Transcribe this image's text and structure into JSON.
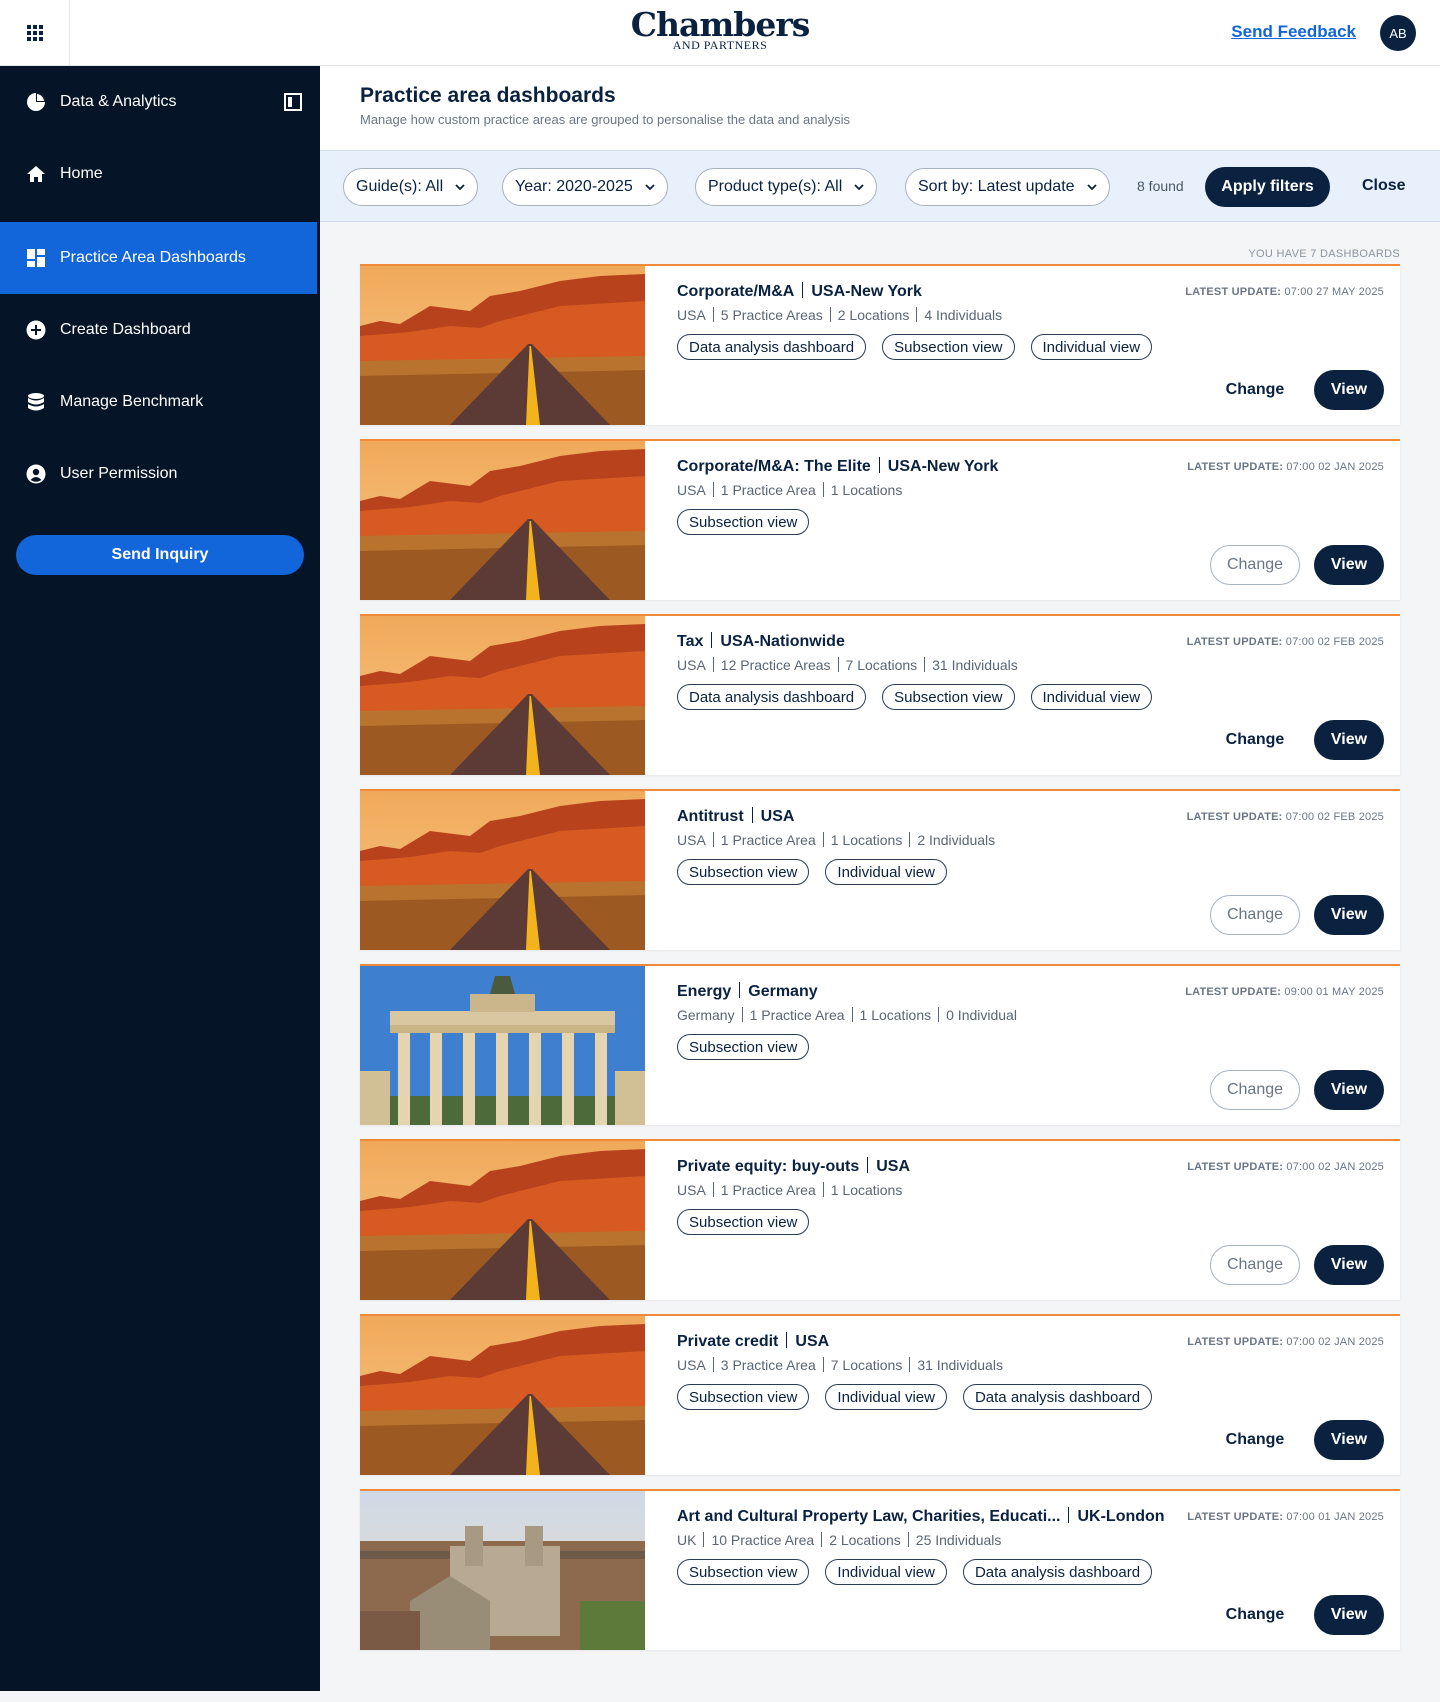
{
  "header": {
    "logo_line1": "Chambers",
    "logo_line2": "AND PARTNERS",
    "feedback": "Send Feedback",
    "avatar": "AB"
  },
  "sidebar": {
    "section": "Data & Analytics",
    "items": [
      {
        "label": "Home",
        "icon": "home-icon"
      },
      {
        "label": "Practice Area Dashboards",
        "icon": "dashboard-icon",
        "active": true
      },
      {
        "label": "Create Dashboard",
        "icon": "plus-circle-icon"
      },
      {
        "label": "Manage Benchmark",
        "icon": "database-icon"
      },
      {
        "label": "User Permission",
        "icon": "user-circle-icon"
      }
    ],
    "inquiry": "Send Inquiry"
  },
  "page": {
    "title": "Practice area dashboards",
    "subtitle": "Manage how custom practice areas are grouped to personalise the data and analysis"
  },
  "filters": {
    "guides": "Guide(s): All",
    "year": "Year: 2020-2025",
    "product": "Product type(s): All",
    "sort": "Sort by: Latest update",
    "found": "8 found",
    "apply": "Apply filters",
    "close": "Close"
  },
  "count_label": "YOU HAVE 7 DASHBOARDS",
  "update_label": "LATEST UPDATE:",
  "change_label": "Change",
  "view_label": "View",
  "dashboards": [
    {
      "title": "Corporate/M&A",
      "location": "USA-New York",
      "meta": [
        "USA",
        "5 Practice Areas",
        "2 Locations",
        "4 Individuals"
      ],
      "tags": [
        "Data analysis dashboard",
        "Subsection view",
        "Individual view"
      ],
      "updated": "07:00 27 MAY 2025",
      "image": "canyon-road",
      "change_outlined": false
    },
    {
      "title": "Corporate/M&A: The Elite",
      "location": "USA-New York",
      "meta": [
        "USA",
        "1 Practice Area",
        "1 Locations"
      ],
      "tags": [
        "Subsection view"
      ],
      "updated": "07:00 02 JAN 2025",
      "image": "canyon-road",
      "change_outlined": true
    },
    {
      "title": "Tax",
      "location": "USA-Nationwide",
      "meta": [
        "USA",
        "12 Practice Areas",
        "7 Locations",
        "31 Individuals"
      ],
      "tags": [
        "Data analysis dashboard",
        "Subsection view",
        "Individual view"
      ],
      "updated": "07:00 02 FEB 2025",
      "image": "canyon-road",
      "change_outlined": false
    },
    {
      "title": "Antitrust",
      "location": "USA",
      "meta": [
        "USA",
        "1 Practice Area",
        "1 Locations",
        "2 Individuals"
      ],
      "tags": [
        "Subsection view",
        "Individual view"
      ],
      "updated": "07:00 02 FEB 2025",
      "image": "canyon-road",
      "change_outlined": true
    },
    {
      "title": "Energy",
      "location": "Germany",
      "meta": [
        "Germany",
        "1 Practice Area",
        "1 Locations",
        "0 Individual"
      ],
      "tags": [
        "Subsection view"
      ],
      "updated": "09:00 01 MAY 2025",
      "image": "brandenburg-gate",
      "change_outlined": true
    },
    {
      "title": "Private equity: buy-outs",
      "location": "USA",
      "meta": [
        "USA",
        "1 Practice Area",
        "1 Locations"
      ],
      "tags": [
        "Subsection view"
      ],
      "updated": "07:00 02 JAN 2025",
      "image": "canyon-road",
      "change_outlined": true
    },
    {
      "title": "Private credit",
      "location": "USA",
      "meta": [
        "USA",
        "3 Practice Area",
        "7 Locations",
        "31 Individuals"
      ],
      "tags": [
        "Subsection view",
        "Individual view",
        "Data analysis dashboard"
      ],
      "updated": "07:00 02 JAN 2025",
      "image": "canyon-road",
      "change_outlined": false
    },
    {
      "title": "Art and Cultural Property Law, Charities, Educati...",
      "location": "UK-London",
      "meta": [
        "UK",
        "10 Practice Area",
        "2 Locations",
        "25 Individuals"
      ],
      "tags": [
        "Subsection view",
        "Individual view",
        "Data analysis dashboard"
      ],
      "updated": "07:00 01 JAN 2025",
      "image": "cathedral-city",
      "change_outlined": false
    }
  ]
}
